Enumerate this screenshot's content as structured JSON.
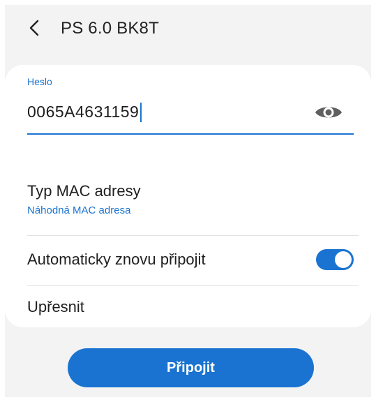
{
  "header": {
    "title": "PS 6.0 BK8T",
    "back_icon": "chevron-left-icon"
  },
  "password": {
    "label": "Heslo",
    "value": "0065A4631159",
    "toggle_icon": "eye-icon"
  },
  "mac_type": {
    "title": "Typ MAC adresy",
    "value": "Náhodná MAC adresa"
  },
  "auto_reconnect": {
    "label": "Automaticky znovu připojit",
    "enabled": true
  },
  "advanced": {
    "label": "Upřesnit"
  },
  "connect_button": {
    "label": "Připojit"
  },
  "colors": {
    "accent": "#1a73d0",
    "background": "#f3f3f3",
    "card": "#ffffff"
  }
}
